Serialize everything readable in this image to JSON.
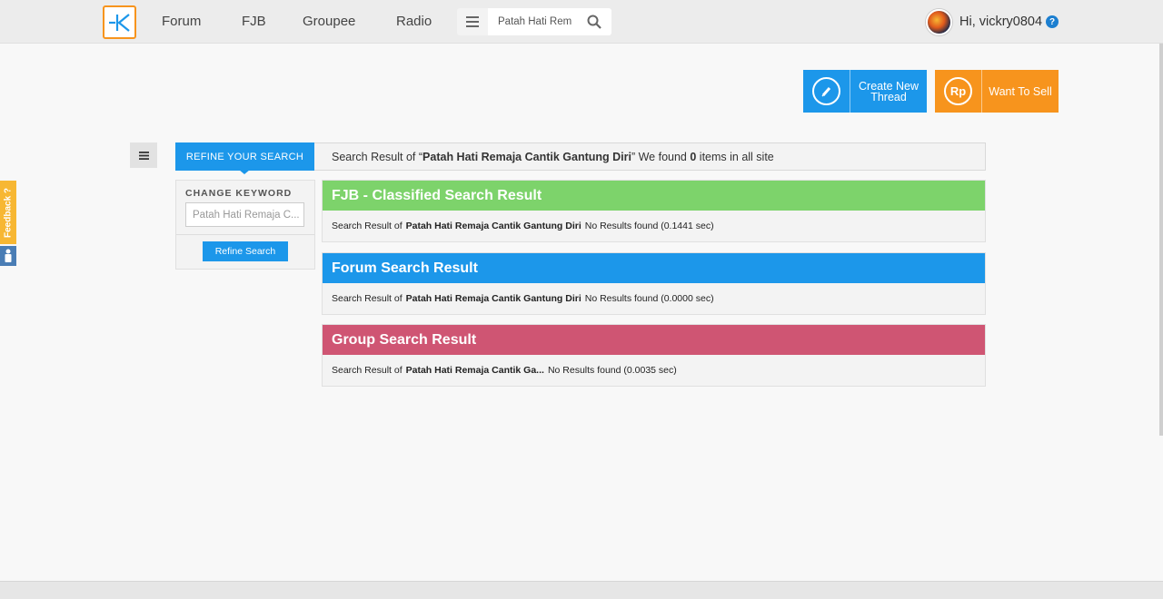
{
  "nav": {
    "links": [
      "Forum",
      "FJB",
      "Groupee",
      "Radio"
    ],
    "search_value": "Patah Hati Rem",
    "greeting": "Hi, vickry0804",
    "help": "?"
  },
  "actions": {
    "create_thread": "Create New Thread",
    "want_to_sell": "Want To Sell",
    "sell_icon_text": "Rp"
  },
  "feedback": {
    "label": "Feedback ?"
  },
  "result_bar": {
    "tab_label": "REFINE YOUR SEARCH",
    "prefix": "Search Result of “",
    "query": "Patah Hati Remaja Cantik Gantung Diri",
    "middle": "” We found ",
    "count": "0",
    "suffix": " items in all site"
  },
  "refine": {
    "keyword_label": "CHANGE KEYWORD",
    "keyword_value": "Patah Hati Remaja C...",
    "button_label": "Refine Search"
  },
  "sections": [
    {
      "title": "FJB - Classified Search Result",
      "color": "#7dd36b",
      "prefix": "Search Result of",
      "query": "Patah Hati Remaja Cantik Gantung Diri",
      "result": " No Results found (0.1441 sec)"
    },
    {
      "title": "Forum Search Result",
      "color": "#1c97ea",
      "prefix": "Search Result of",
      "query": "Patah Hati Remaja Cantik Gantung Diri",
      "result": "No Results found (0.0000 sec)"
    },
    {
      "title": "Group Search Result",
      "color": "#cf5573",
      "prefix": "Search Result of",
      "query": "Patah Hati Remaja Cantik Ga...",
      "result": "No Results found (0.0035 sec)"
    }
  ],
  "colors": {
    "brand_orange": "#f7941d",
    "primary_blue": "#1c97ea"
  }
}
